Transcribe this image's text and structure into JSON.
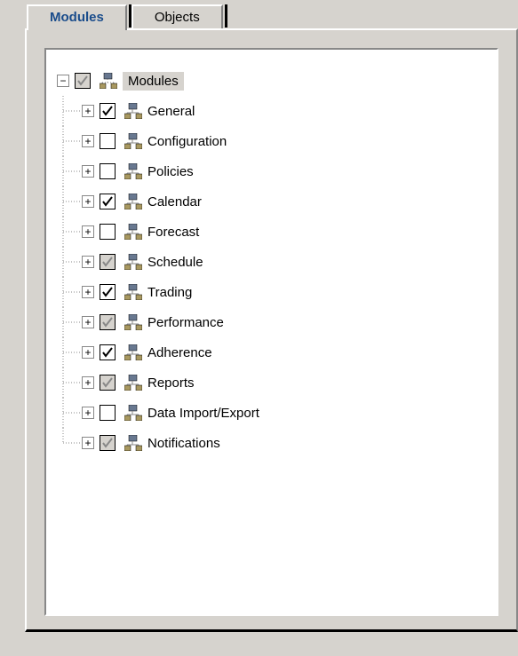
{
  "tabs": {
    "active": "Modules",
    "inactive": "Objects"
  },
  "tree": {
    "root": {
      "expanded": true,
      "state": "tri",
      "label": "Modules",
      "selected": true
    },
    "children": [
      {
        "state": "checked",
        "label": "General"
      },
      {
        "state": "unchecked",
        "label": "Configuration"
      },
      {
        "state": "unchecked",
        "label": "Policies"
      },
      {
        "state": "checked",
        "label": "Calendar"
      },
      {
        "state": "unchecked",
        "label": "Forecast"
      },
      {
        "state": "tri",
        "label": "Schedule"
      },
      {
        "state": "checked",
        "label": "Trading"
      },
      {
        "state": "tri",
        "label": "Performance"
      },
      {
        "state": "checked",
        "label": "Adherence"
      },
      {
        "state": "tri",
        "label": "Reports"
      },
      {
        "state": "unchecked",
        "label": "Data Import/Export"
      },
      {
        "state": "tri",
        "label": "Notifications"
      }
    ]
  }
}
